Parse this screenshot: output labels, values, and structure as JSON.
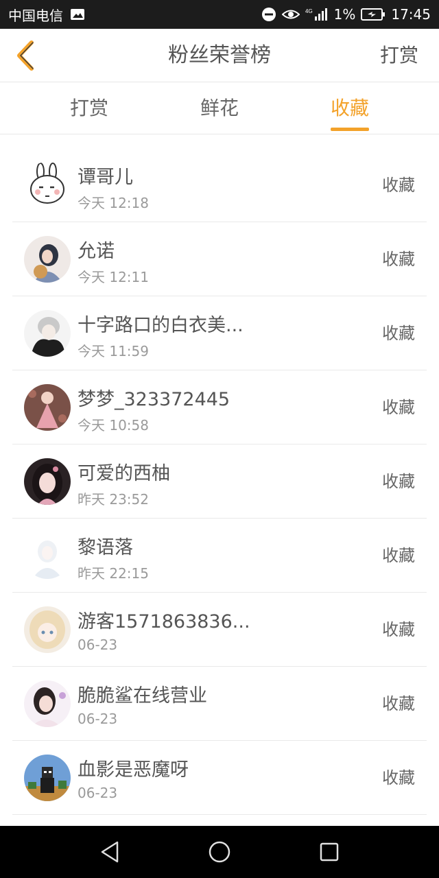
{
  "status_bar": {
    "carrier": "中国电信",
    "battery": "1%",
    "time": "17:45",
    "network": "4G"
  },
  "header": {
    "title": "粉丝荣誉榜",
    "action": "打赏"
  },
  "tabs": [
    {
      "label": "打赏",
      "active": false
    },
    {
      "label": "鲜花",
      "active": false
    },
    {
      "label": "收藏",
      "active": true
    }
  ],
  "fans": [
    {
      "name": "谭哥儿",
      "time": "今天 12:18",
      "action": "收藏",
      "avatar": "rabbit-avatar"
    },
    {
      "name": "允诺",
      "time": "今天 12:11",
      "action": "收藏",
      "avatar": "girl-avatar"
    },
    {
      "name": "十字路口的白衣美...",
      "time": "今天 11:59",
      "action": "收藏",
      "avatar": "hooded-boy-avatar"
    },
    {
      "name": "梦梦_323372445",
      "time": "今天 10:58",
      "action": "收藏",
      "avatar": "pink-dress-avatar"
    },
    {
      "name": "可爱的西柚",
      "time": "昨天 23:52",
      "action": "收藏",
      "avatar": "dark-hair-girl-avatar"
    },
    {
      "name": "黎语落",
      "time": "昨天 22:15",
      "action": "收藏",
      "avatar": "white-girl-avatar"
    },
    {
      "name": "游客1571863836...",
      "time": "06-23",
      "action": "收藏",
      "avatar": "anime-girl-avatar"
    },
    {
      "name": "脆脆鲨在线营业",
      "time": "06-23",
      "action": "收藏",
      "avatar": "photo-girl-avatar"
    },
    {
      "name": "血影是恶魔呀",
      "time": "06-23",
      "action": "收藏",
      "avatar": "pixel-character-avatar"
    }
  ],
  "colors": {
    "accent": "#f3a22a",
    "status_bar": "#1c1c1c",
    "nav_bar": "#000000",
    "text": "#555555",
    "subtext": "#9a9a9a"
  }
}
